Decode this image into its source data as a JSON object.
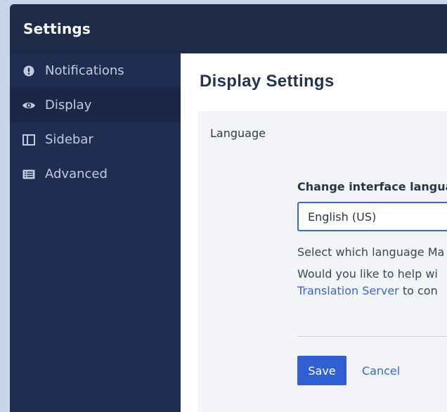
{
  "window": {
    "title": "Settings"
  },
  "sidebar": {
    "items": [
      {
        "label": "Notifications",
        "icon": "exclamation-circle-icon",
        "active": false
      },
      {
        "label": "Display",
        "icon": "eye-icon",
        "active": true
      },
      {
        "label": "Sidebar",
        "icon": "sidebar-layout-icon",
        "active": false
      },
      {
        "label": "Advanced",
        "icon": "list-panel-icon",
        "active": false
      }
    ]
  },
  "main": {
    "title": "Display Settings",
    "section_label": "Language",
    "language_field": {
      "label": "Change interface langua",
      "selected_value": "English (US)"
    },
    "help_text": "Select which language Ma",
    "contribute_text_1": "Would you like to help wi",
    "contribute_link": "Translation Server",
    "contribute_text_2": "to con",
    "save_label": "Save",
    "cancel_label": "Cancel"
  },
  "colors": {
    "titlebar": "#1d2a48",
    "sidebar": "#1e2d50",
    "accent": "#3b66cf",
    "panel": "#f3f4f7"
  }
}
